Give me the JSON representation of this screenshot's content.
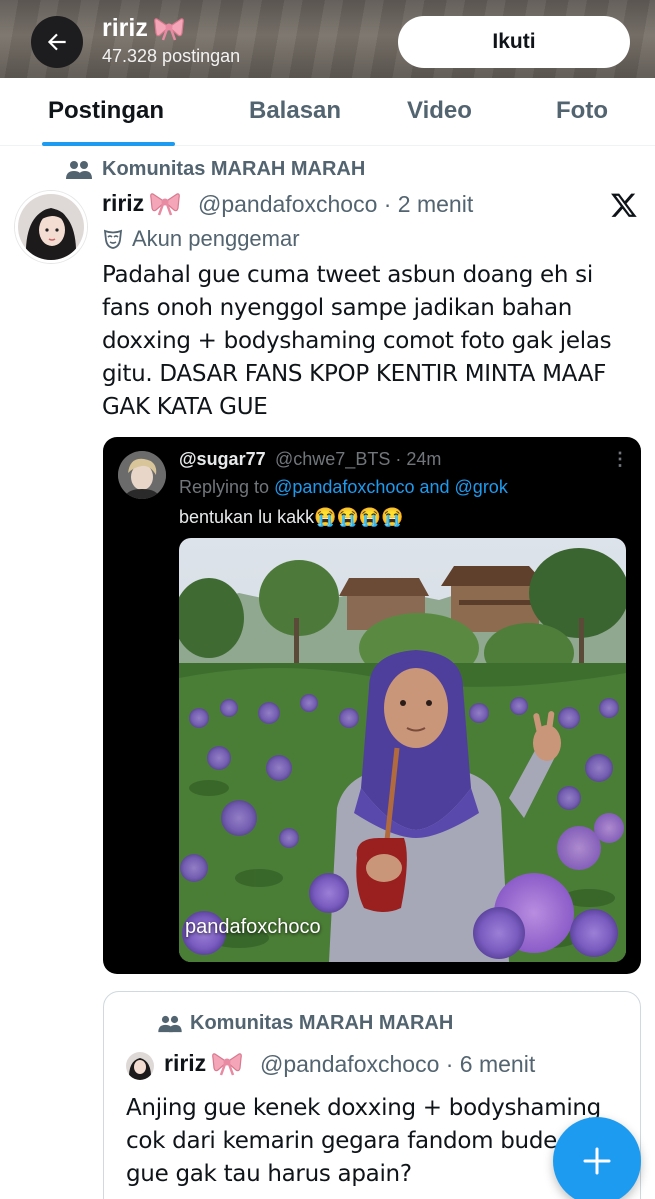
{
  "header": {
    "name": "ririz",
    "post_count": "47.328 postingan",
    "follow_label": "Ikuti"
  },
  "tabs": [
    {
      "label": "Postingan",
      "active": true
    },
    {
      "label": "Balasan",
      "active": false
    },
    {
      "label": "Video",
      "active": false
    },
    {
      "label": "Foto",
      "active": false
    }
  ],
  "tweet": {
    "community": "Komunitas MARAH MARAH",
    "name": "ririz",
    "handle_time": "@pandafoxchoco · 2 menit",
    "fan_label": "Akun penggemar",
    "text": "Padahal gue cuma tweet asbun doang eh si fans onoh nyenggol sampe jadikan bahan doxxing + bodyshaming comot foto gak jelas gitu. DASAR FANS KPOP KENTIR MINTA MAAF GAK KATA GUE"
  },
  "embedded": {
    "name": "@sugar77",
    "handle_time": "@chwe7_BTS · 24m",
    "more": "⋮",
    "replying_prefix": "Replying to",
    "replying_user1": "@pandafoxchoco",
    "replying_and": "and",
    "replying_user2": "@grok",
    "text": "bentukan lu kakk😭😭😭😭",
    "watermark": "pandafoxchoco"
  },
  "quoted": {
    "community": "Komunitas MARAH MARAH",
    "name": "ririz",
    "handle_time": "@pandafoxchoco · 6 menit",
    "text": "Anjing gue kenek doxxing + bodyshaming cok dari kemarin gegara fandom bude jelas gue gak tau harus apain?"
  },
  "colors": {
    "accent": "#1d9bf0",
    "text_primary": "#0f1419",
    "text_secondary": "#536471"
  },
  "icons": [
    "back-arrow-icon",
    "bow-icon",
    "community-icon",
    "x-logo-icon",
    "fan-mask-icon",
    "more-icon",
    "compose-plus-icon"
  ]
}
